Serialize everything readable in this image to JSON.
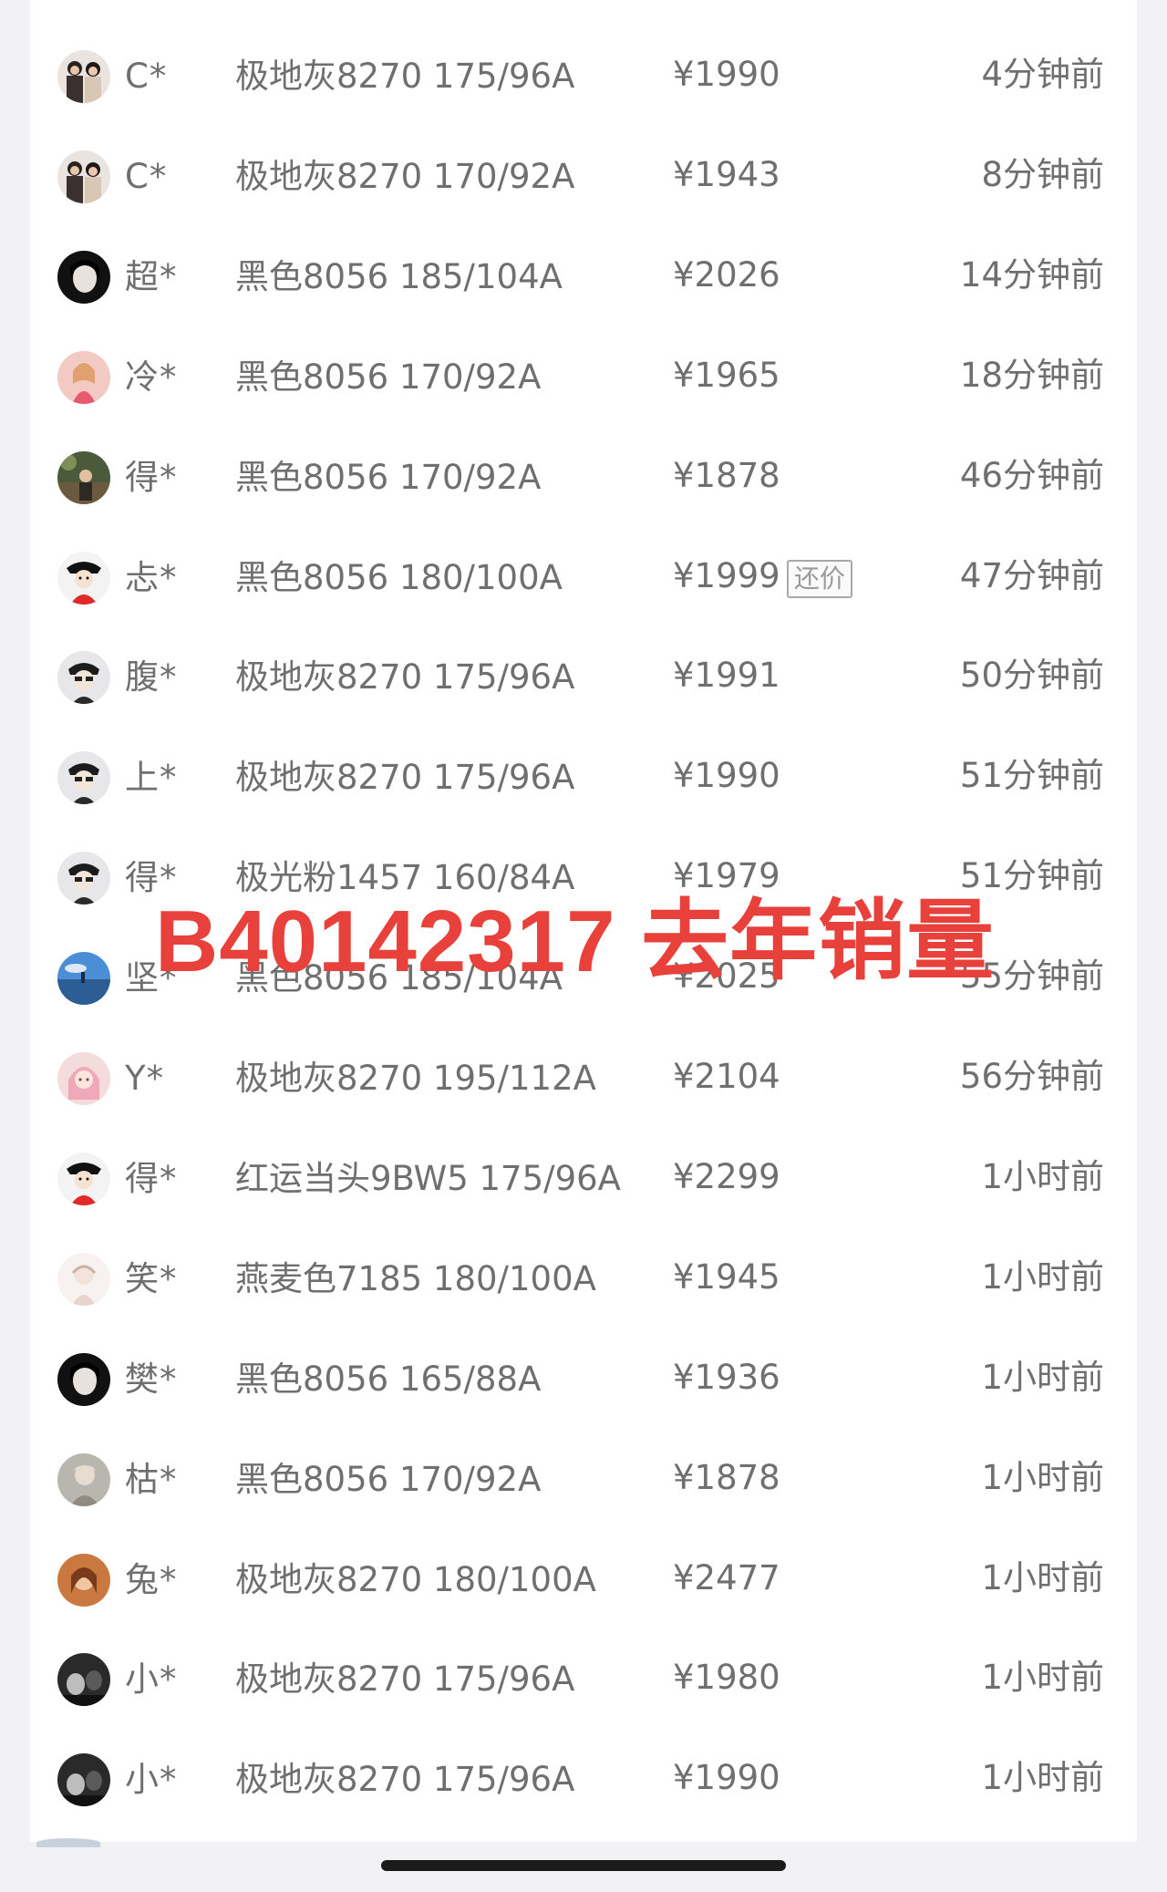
{
  "overlay": {
    "text": "B40142317 去年销量",
    "color": "#e8403a"
  },
  "records": [
    {
      "user": "C*",
      "product": "极地灰8270 175/96A",
      "price": "¥1990",
      "time": "4分钟前",
      "avatar": "couple-photo-avatar"
    },
    {
      "user": "C*",
      "product": "极地灰8270 170/92A",
      "price": "¥1943",
      "time": "8分钟前",
      "avatar": "couple-photo-avatar"
    },
    {
      "user": "超*",
      "product": "黑色8056 185/104A",
      "price": "¥2026",
      "time": "14分钟前",
      "avatar": "dark-portrait-avatar"
    },
    {
      "user": "冷*",
      "product": "黑色8056 170/92A",
      "price": "¥1965",
      "time": "18分钟前",
      "avatar": "pink-portrait-avatar"
    },
    {
      "user": "得*",
      "product": "黑色8056 170/92A",
      "price": "¥1878",
      "time": "46分钟前",
      "avatar": "outdoor-photo-avatar"
    },
    {
      "user": "忐*",
      "product": "黑色8056 180/100A",
      "price": "¥1999",
      "badge": "还价",
      "time": "47分钟前",
      "avatar": "cartoon-red-avatar"
    },
    {
      "user": "腹*",
      "product": "极地灰8270 175/96A",
      "price": "¥1991",
      "time": "50分钟前",
      "avatar": "cartoon-character-avatar"
    },
    {
      "user": "上*",
      "product": "极地灰8270 175/96A",
      "price": "¥1990",
      "time": "51分钟前",
      "avatar": "cartoon-character-avatar"
    },
    {
      "user": "得*",
      "product": "极光粉1457 160/84A",
      "price": "¥1979",
      "time": "51分钟前",
      "avatar": "cartoon-character-avatar"
    },
    {
      "user": "坚*",
      "product": "黑色8056 185/104A",
      "price": "¥2025",
      "time": "55分钟前",
      "avatar": "sky-landscape-avatar"
    },
    {
      "user": "Y*",
      "product": "极地灰8270 195/112A",
      "price": "¥2104",
      "time": "56分钟前",
      "avatar": "anime-girl-avatar"
    },
    {
      "user": "得*",
      "product": "红运当头9BW5 175/96A",
      "price": "¥2299",
      "time": "1小时前",
      "avatar": "cartoon-red-avatar"
    },
    {
      "user": "笑*",
      "product": "燕麦色7185 180/100A",
      "price": "¥1945",
      "time": "1小时前",
      "avatar": "light-sketch-avatar"
    },
    {
      "user": "樊*",
      "product": "黑色8056 165/88A",
      "price": "¥1936",
      "time": "1小时前",
      "avatar": "dark-portrait-avatar"
    },
    {
      "user": "枯*",
      "product": "黑色8056 170/92A",
      "price": "¥1878",
      "time": "1小时前",
      "avatar": "grey-photo-avatar"
    },
    {
      "user": "兔*",
      "product": "极地灰8270 180/100A",
      "price": "¥2477",
      "time": "1小时前",
      "avatar": "warm-portrait-avatar"
    },
    {
      "user": "小*",
      "product": "极地灰8270 175/96A",
      "price": "¥1980",
      "time": "1小时前",
      "avatar": "dark-photo-avatar"
    },
    {
      "user": "小*",
      "product": "极地灰8270 175/96A",
      "price": "¥1990",
      "time": "1小时前",
      "avatar": "dark-photo-avatar"
    }
  ]
}
